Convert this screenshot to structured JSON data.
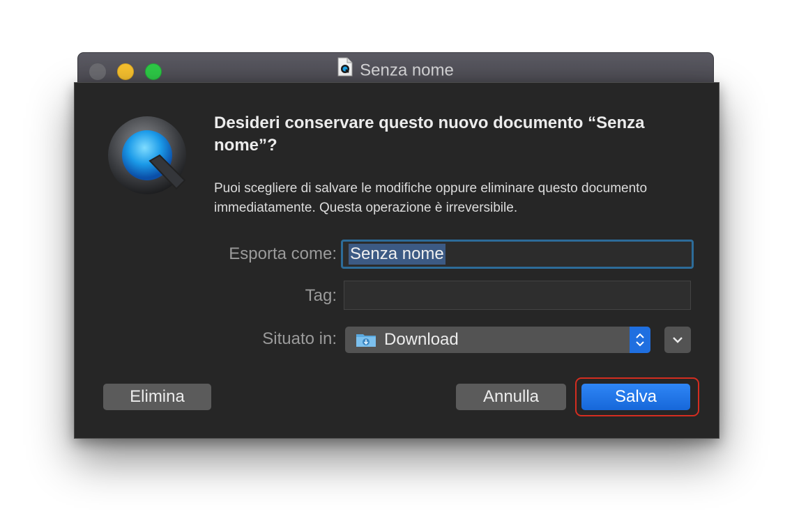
{
  "window": {
    "title": "Senza nome",
    "title_icon": "quicktime-document-icon"
  },
  "dialog": {
    "app_icon": "quicktime-icon",
    "heading": "Desideri conservare questo nuovo documento “Senza nome”?",
    "message": "Puoi scegliere di salvare le modifiche oppure eliminare questo documento immediatamente. Questa operazione è irreversibile.",
    "export_label": "Esporta come:",
    "export_value": "Senza nome",
    "tag_label": "Tag:",
    "tag_value": "",
    "location_label": "Situato in:",
    "location_value": "Download",
    "location_icon": "downloads-folder-icon",
    "delete_label": "Elimina",
    "cancel_label": "Annulla",
    "save_label": "Salva"
  },
  "colors": {
    "sheet_background": "#262626",
    "accent": "#1f6fe0",
    "focus_ring": "#2d6c99",
    "highlight": "#d42d20"
  }
}
